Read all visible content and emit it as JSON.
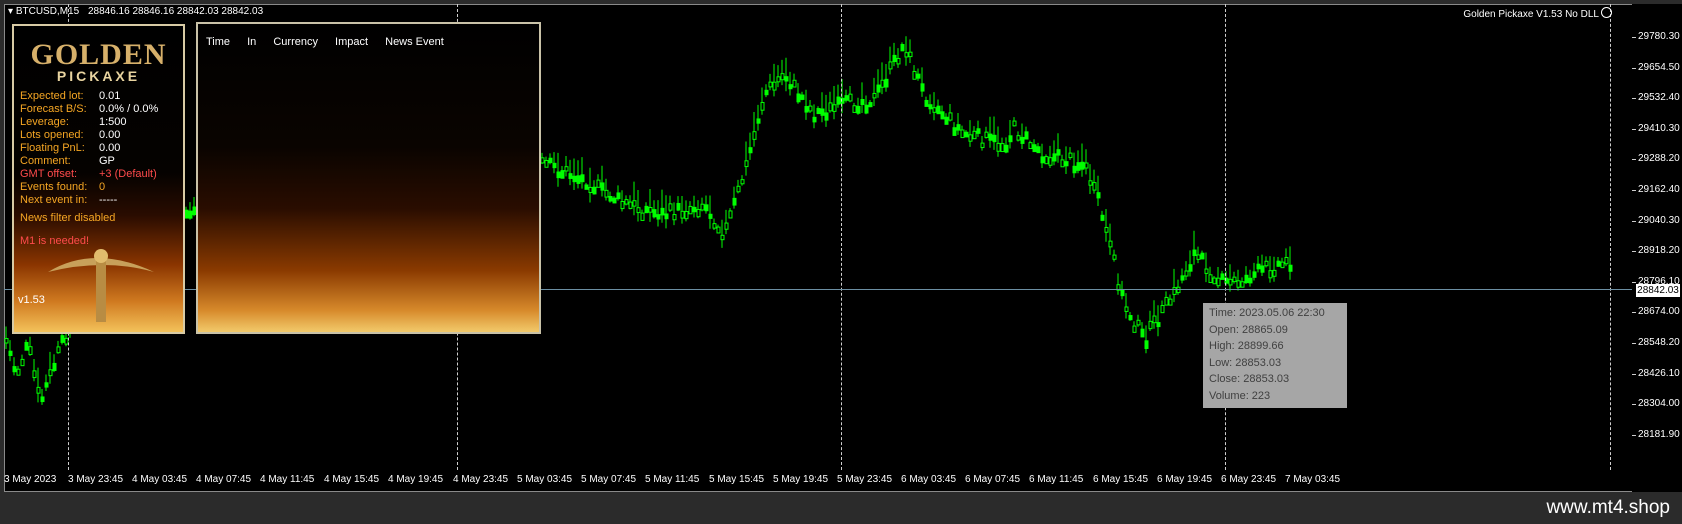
{
  "header": {
    "symbol": "BTCUSD,M15",
    "ohlc": "28846.16 28846.16 28842.03 28842.03",
    "ea_name": "Golden Pickaxe V1.53 No DLL"
  },
  "price_scale": {
    "ticks": [
      "29780.30",
      "29654.50",
      "29532.40",
      "29410.30",
      "29288.20",
      "29162.40",
      "29040.30",
      "28918.20",
      "28796.10",
      "28674.00",
      "28548.20",
      "28426.10",
      "28304.00",
      "28181.90"
    ],
    "current_price": "28842.03"
  },
  "time_axis": {
    "labels": [
      "3 May 2023",
      "3 May 23:45",
      "4 May 03:45",
      "4 May 07:45",
      "4 May 11:45",
      "4 May 15:45",
      "4 May 19:45",
      "4 May 23:45",
      "5 May 03:45",
      "5 May 07:45",
      "5 May 11:45",
      "5 May 15:45",
      "5 May 19:45",
      "5 May 23:45",
      "6 May 03:45",
      "6 May 07:45",
      "6 May 11:45",
      "6 May 15:45",
      "6 May 19:45",
      "6 May 23:45",
      "7 May 03:45"
    ]
  },
  "panel": {
    "logo_top": "GOLDEN",
    "logo_bottom": "PICKAXE",
    "rows": [
      {
        "key": "Expected lot:",
        "value": "0.01",
        "color": "#f5a623",
        "vcolor": "#ffffff"
      },
      {
        "key": "Forecast B/S:",
        "value": "0.0% / 0.0%",
        "color": "#f5a623",
        "vcolor": "#ffffff"
      },
      {
        "key": "Leverage:",
        "value": "1:500",
        "color": "#f5a623",
        "vcolor": "#ffffff"
      },
      {
        "key": "Lots opened:",
        "value": "0.00",
        "color": "#f5a623",
        "vcolor": "#ffffff"
      },
      {
        "key": "Floating PnL:",
        "value": "0.00",
        "color": "#f5a623",
        "vcolor": "#ffffff"
      },
      {
        "key": "Comment:",
        "value": "GP",
        "color": "#f5a623",
        "vcolor": "#ffffff"
      },
      {
        "key": "GMT offset:",
        "value": "+3 (Default)",
        "color": "#ff4b4b",
        "vcolor": "#ff4b4b"
      },
      {
        "key": "Events found:",
        "value": "0",
        "color": "#f5a623",
        "vcolor": "#f5a623"
      },
      {
        "key": "Next event in:",
        "value": "-----",
        "color": "#f5a623",
        "vcolor": "#ffffff"
      }
    ],
    "news_status": "News filter disabled",
    "m1_warning": "M1 is needed!",
    "version": "v1.53"
  },
  "news_table": {
    "columns": [
      "Time",
      "In",
      "Currency",
      "Impact",
      "News Event"
    ]
  },
  "tooltip": {
    "time": "Time: 2023.05.06 22:30",
    "open": "Open: 28865.09",
    "high": "High: 28899.66",
    "low": "Low:  28853.03",
    "close": "Close: 28853.03",
    "volume": "Volume: 223"
  },
  "footer": {
    "brand": "www.mt4.shop"
  },
  "colors": {
    "candle": "#00ff00",
    "background": "#000000",
    "accent": "#f5a623"
  }
}
